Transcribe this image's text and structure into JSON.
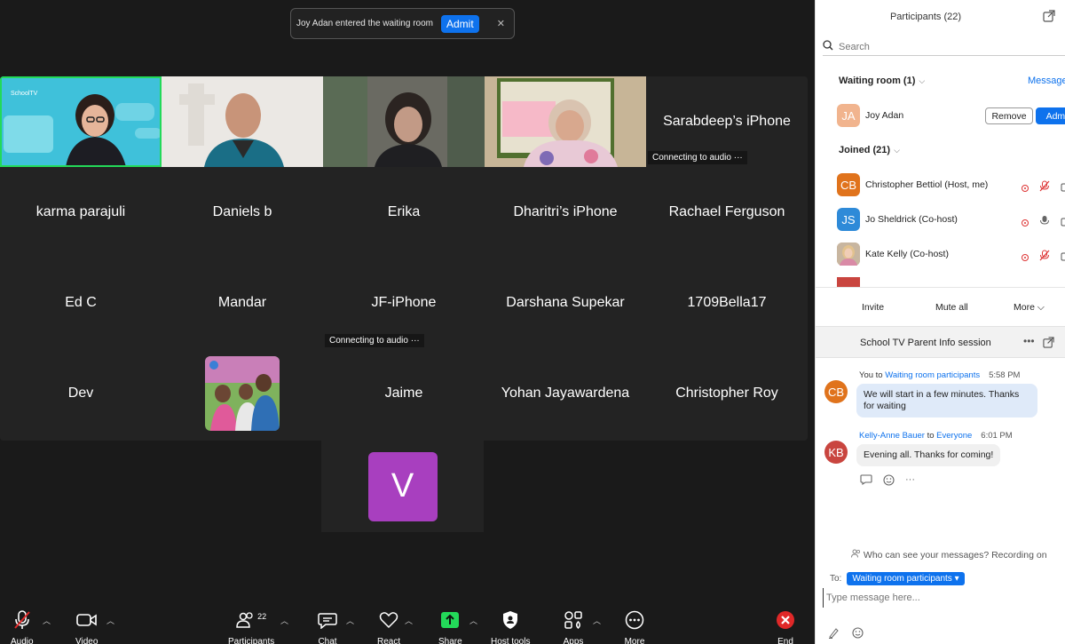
{
  "notification": {
    "message": "Joy Adan entered the waiting room",
    "admit_label": "Admit"
  },
  "tiles": [
    {
      "name": "",
      "video": "schooltv",
      "active": true
    },
    {
      "name": "",
      "video": "man"
    },
    {
      "name": "",
      "video": "woman-blur"
    },
    {
      "name": "",
      "video": "classroom"
    },
    {
      "name": "Sarabdeep’s iPhone",
      "status": "Connecting to audio"
    },
    {
      "name": "karma parajuli"
    },
    {
      "name": "Daniels b"
    },
    {
      "name": "Erika"
    },
    {
      "name": "Dharitri’s iPhone"
    },
    {
      "name": "Rachael Ferguson"
    },
    {
      "name": "Ed C"
    },
    {
      "name": "Mandar"
    },
    {
      "name": "JF-iPhone",
      "status": "Connecting to audio"
    },
    {
      "name": "Darshana Supekar"
    },
    {
      "name": "1709Bella17"
    },
    {
      "name": "Dev"
    },
    {
      "name": "",
      "photo": "family"
    },
    {
      "name": "Jaime"
    },
    {
      "name": "Yohan Jayawardena"
    },
    {
      "name": "Christopher Roy"
    }
  ],
  "v_tile": {
    "initial": "V",
    "color": "#a83fbf"
  },
  "schooltv_label": "SchoolTV",
  "toolbar": {
    "audio": "Audio",
    "video": "Video",
    "participants": "Participants",
    "participants_count": "22",
    "chat": "Chat",
    "react": "React",
    "share": "Share",
    "host_tools": "Host tools",
    "apps": "Apps",
    "more": "More",
    "end": "End"
  },
  "panel": {
    "title": "Participants (22)",
    "search_placeholder": "Search",
    "waiting_room": "Waiting room (1)",
    "message_link": "Message",
    "waiting_user": {
      "initials": "JA",
      "name": "Joy Adan",
      "color": "#f1b48e"
    },
    "remove": "Remove",
    "admit": "Admit",
    "joined": "Joined (21)",
    "joined_users": [
      {
        "initials": "CB",
        "name": "Christopher Bettiol (Host, me)",
        "color": "#e0731c",
        "mic": "muted"
      },
      {
        "initials": "JS",
        "name": "Jo Sheldrick (Co-host)",
        "color": "#2e8ad8",
        "mic": "on"
      },
      {
        "initials": "",
        "name": "Kate Kelly (Co-host)",
        "color": "#c9a37f",
        "mic": "muted"
      }
    ],
    "invite": "Invite",
    "mute_all": "Mute all",
    "more": "More"
  },
  "chat": {
    "title": "School TV Parent Info session",
    "messages": [
      {
        "initials": "CB",
        "color": "#e0731c",
        "from": "You",
        "to_word": "to",
        "to": "Waiting room participants",
        "time": "5:58 PM",
        "text": "We will start in a few minutes. Thanks for waiting"
      },
      {
        "initials": "KB",
        "color": "#c9453f",
        "from": "Kelly-Anne Bauer",
        "to_word": "to",
        "to": "Everyone",
        "time": "6:01 PM",
        "text": "Evening all. Thanks for coming!"
      }
    ],
    "who_can_see": "Who can see your messages? Recording on",
    "to_label": "To:",
    "recipient": "Waiting room participants",
    "input_placeholder": "Type message here..."
  }
}
